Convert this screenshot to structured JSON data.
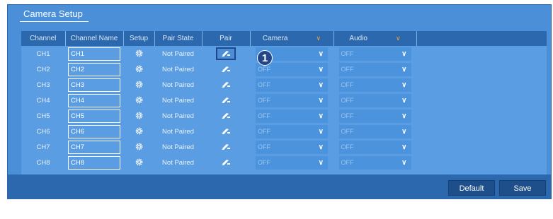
{
  "window": {
    "title": "Camera Setup"
  },
  "columns": {
    "channel": "Channel",
    "channel_name": "Channel Name",
    "setup": "Setup",
    "pair_state": "Pair State",
    "pair": "Pair",
    "camera": "Camera",
    "audio": "Audio"
  },
  "rows": [
    {
      "channel": "CH1",
      "name": "CH1",
      "state": "Not Paired",
      "camera": "",
      "audio": "OFF"
    },
    {
      "channel": "CH2",
      "name": "CH2",
      "state": "Not Paired",
      "camera": "OFF",
      "audio": "OFF"
    },
    {
      "channel": "CH3",
      "name": "CH3",
      "state": "Not Paired",
      "camera": "OFF",
      "audio": "OFF"
    },
    {
      "channel": "CH4",
      "name": "CH4",
      "state": "Not Paired",
      "camera": "OFF",
      "audio": "OFF"
    },
    {
      "channel": "CH5",
      "name": "CH5",
      "state": "Not Paired",
      "camera": "OFF",
      "audio": "OFF"
    },
    {
      "channel": "CH6",
      "name": "CH6",
      "state": "Not Paired",
      "camera": "OFF",
      "audio": "OFF"
    },
    {
      "channel": "CH7",
      "name": "CH7",
      "state": "Not Paired",
      "camera": "OFF",
      "audio": "OFF"
    },
    {
      "channel": "CH8",
      "name": "CH8",
      "state": "Not Paired",
      "camera": "OFF",
      "audio": "OFF"
    }
  ],
  "callout": {
    "number": "1"
  },
  "footer": {
    "default_label": "Default",
    "save_label": "Save"
  },
  "icons": {
    "setup": "gear-icon",
    "pair": "pair-camera-icon",
    "dropdown": "chevron-down-icon"
  },
  "colors": {
    "background": "#4a8fd8",
    "header": "#2b68ae",
    "callout": "#23478a",
    "accent": "#f2a93b"
  }
}
